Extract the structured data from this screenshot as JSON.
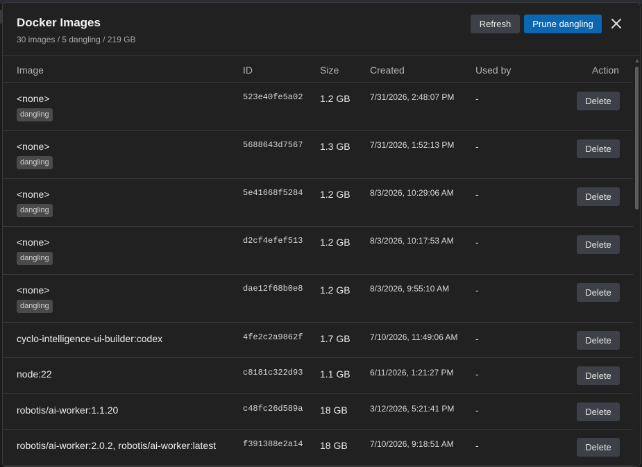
{
  "dialog": {
    "title": "Docker Images",
    "summary": "30 images / 5 dangling / 219 GB",
    "refresh_label": "Refresh",
    "prune_label": "Prune dangling",
    "close_icon": "close-icon"
  },
  "table": {
    "headers": {
      "image": "Image",
      "id": "ID",
      "size": "Size",
      "created": "Created",
      "used_by": "Used by",
      "action": "Action"
    },
    "delete_label": "Delete",
    "rows": [
      {
        "name": "<none>",
        "badge": "dangling",
        "id": "523e40fe5a02",
        "size": "1.2 GB",
        "created": "7/31/2026, 2:48:07 PM",
        "used_by": "-"
      },
      {
        "name": "<none>",
        "badge": "dangling",
        "id": "5688643d7567",
        "size": "1.3 GB",
        "created": "7/31/2026, 1:52:13 PM",
        "used_by": "-"
      },
      {
        "name": "<none>",
        "badge": "dangling",
        "id": "5e41668f5284",
        "size": "1.2 GB",
        "created": "8/3/2026, 10:29:06 AM",
        "used_by": "-"
      },
      {
        "name": "<none>",
        "badge": "dangling",
        "id": "d2cf4efef513",
        "size": "1.2 GB",
        "created": "8/3/2026, 10:17:53 AM",
        "used_by": "-"
      },
      {
        "name": "<none>",
        "badge": "dangling",
        "id": "dae12f68b0e8",
        "size": "1.2 GB",
        "created": "8/3/2026, 9:55:10 AM",
        "used_by": "-"
      },
      {
        "name": "cyclo-intelligence-ui-builder:codex",
        "id": "4fe2c2a9862f",
        "size": "1.7 GB",
        "created": "7/10/2026, 11:49:06 AM",
        "used_by": "-"
      },
      {
        "name": "node:22",
        "id": "c8181c322d93",
        "size": "1.1 GB",
        "created": "6/11/2026, 1:21:27 PM",
        "used_by": "-"
      },
      {
        "name": "robotis/ai-worker:1.1.20",
        "id": "c48fc26d589a",
        "size": "18 GB",
        "created": "3/12/2026, 5:21:41 PM",
        "used_by": "-"
      },
      {
        "name": "robotis/ai-worker:2.0.2, robotis/ai-worker:latest",
        "id": "f391388e2a14",
        "size": "18 GB",
        "created": "7/10/2026, 9:18:51 AM",
        "used_by": "-"
      }
    ]
  },
  "colors": {
    "accent": "#0b67b1",
    "surface": "#212121",
    "border": "#3a3a3a"
  }
}
